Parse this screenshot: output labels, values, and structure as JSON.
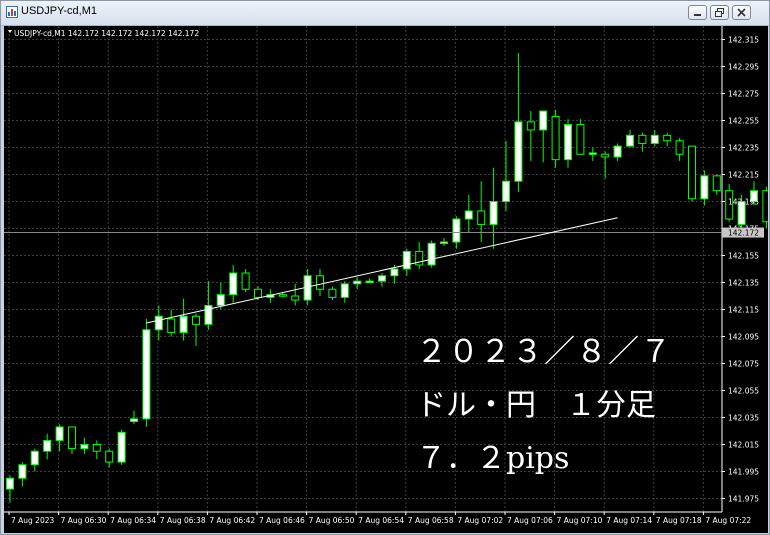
{
  "window": {
    "title": "USDJPY-cd,M1",
    "buttons": [
      "minimize-icon",
      "restore-icon",
      "close-icon"
    ]
  },
  "chart_info": {
    "header": "USDJPY-cd,M1 142.172 142.172 142.172 142.172",
    "current_price_label": "142.172"
  },
  "overlay": {
    "line1": "２０２３／８／７",
    "line2": "ドル・円　１分足",
    "line3": "７．２pips"
  },
  "colors": {
    "background": "#000000",
    "grid": "#3c3c3c",
    "bull_fill": "#ffffff",
    "bear_fill": "#000000",
    "candle_outline": "#00ff00",
    "axis_text": "#ffffff",
    "price_line": "#8a8a8a"
  },
  "chart_data": {
    "type": "candlestick",
    "symbol": "USDJPY-cd",
    "timeframe": "M1",
    "ylim": [
      141.965,
      142.325
    ],
    "y_ticks": [
      "142.315",
      "142.295",
      "142.275",
      "142.255",
      "142.235",
      "142.215",
      "142.195",
      "142.175",
      "142.155",
      "142.135",
      "142.115",
      "142.095",
      "142.075",
      "142.055",
      "142.035",
      "142.015",
      "141.995",
      "141.975"
    ],
    "y_tick_values": [
      142.315,
      142.295,
      142.275,
      142.255,
      142.235,
      142.215,
      142.195,
      142.175,
      142.155,
      142.135,
      142.115,
      142.095,
      142.075,
      142.055,
      142.035,
      142.015,
      141.995,
      141.975
    ],
    "x_ticks": [
      "7 Aug 2023",
      "7 Aug 06:30",
      "7 Aug 06:34",
      "7 Aug 06:38",
      "7 Aug 06:42",
      "7 Aug 06:46",
      "7 Aug 06:50",
      "7 Aug 06:54",
      "7 Aug 06:58",
      "7 Aug 07:02",
      "7 Aug 07:06",
      "7 Aug 07:10",
      "7 Aug 07:14",
      "7 Aug 07:18",
      "7 Aug 07:22"
    ],
    "current_price": 142.172,
    "trendline": {
      "from": [
        11,
        142.105
      ],
      "to": [
        49,
        142.183
      ]
    },
    "candles": [
      {
        "o": 141.982,
        "h": 141.992,
        "l": 141.972,
        "c": 141.99
      },
      {
        "o": 141.99,
        "h": 142.002,
        "l": 141.984,
        "c": 142.0
      },
      {
        "o": 142.0,
        "h": 142.012,
        "l": 141.995,
        "c": 142.01
      },
      {
        "o": 142.01,
        "h": 142.023,
        "l": 142.004,
        "c": 142.018
      },
      {
        "o": 142.018,
        "h": 142.03,
        "l": 142.01,
        "c": 142.028
      },
      {
        "o": 142.028,
        "h": 142.028,
        "l": 142.008,
        "c": 142.012
      },
      {
        "o": 142.012,
        "h": 142.02,
        "l": 142.008,
        "c": 142.015
      },
      {
        "o": 142.015,
        "h": 142.018,
        "l": 142.004,
        "c": 142.01
      },
      {
        "o": 142.01,
        "h": 142.012,
        "l": 141.998,
        "c": 142.002
      },
      {
        "o": 142.002,
        "h": 142.026,
        "l": 142.0,
        "c": 142.024
      },
      {
        "o": 142.032,
        "h": 142.04,
        "l": 142.03,
        "c": 142.034
      },
      {
        "o": 142.034,
        "h": 142.108,
        "l": 142.028,
        "c": 142.1
      },
      {
        "o": 142.1,
        "h": 142.118,
        "l": 142.092,
        "c": 142.11
      },
      {
        "o": 142.108,
        "h": 142.115,
        "l": 142.095,
        "c": 142.098
      },
      {
        "o": 142.098,
        "h": 142.123,
        "l": 142.092,
        "c": 142.11
      },
      {
        "o": 142.11,
        "h": 142.112,
        "l": 142.088,
        "c": 142.104
      },
      {
        "o": 142.104,
        "h": 142.136,
        "l": 142.1,
        "c": 142.118
      },
      {
        "o": 142.118,
        "h": 142.135,
        "l": 142.115,
        "c": 142.126
      },
      {
        "o": 142.126,
        "h": 142.148,
        "l": 142.12,
        "c": 142.142
      },
      {
        "o": 142.142,
        "h": 142.145,
        "l": 142.128,
        "c": 142.13
      },
      {
        "o": 142.13,
        "h": 142.132,
        "l": 142.122,
        "c": 142.124
      },
      {
        "o": 142.124,
        "h": 142.13,
        "l": 142.12,
        "c": 142.126
      },
      {
        "o": 142.126,
        "h": 142.128,
        "l": 142.124,
        "c": 142.125
      },
      {
        "o": 142.125,
        "h": 142.134,
        "l": 142.118,
        "c": 142.122
      },
      {
        "o": 142.122,
        "h": 142.145,
        "l": 142.118,
        "c": 142.14
      },
      {
        "o": 142.14,
        "h": 142.145,
        "l": 142.125,
        "c": 142.13
      },
      {
        "o": 142.13,
        "h": 142.132,
        "l": 142.122,
        "c": 142.124
      },
      {
        "o": 142.124,
        "h": 142.136,
        "l": 142.12,
        "c": 142.134
      },
      {
        "o": 142.134,
        "h": 142.139,
        "l": 142.13,
        "c": 142.136
      },
      {
        "o": 142.136,
        "h": 142.138,
        "l": 142.135,
        "c": 142.136
      },
      {
        "o": 142.136,
        "h": 142.142,
        "l": 142.132,
        "c": 142.14
      },
      {
        "o": 142.14,
        "h": 142.148,
        "l": 142.134,
        "c": 142.145
      },
      {
        "o": 142.145,
        "h": 142.16,
        "l": 142.14,
        "c": 142.158
      },
      {
        "o": 142.158,
        "h": 142.165,
        "l": 142.145,
        "c": 142.148
      },
      {
        "o": 142.148,
        "h": 142.166,
        "l": 142.146,
        "c": 142.164
      },
      {
        "o": 142.164,
        "h": 142.168,
        "l": 142.162,
        "c": 142.165
      },
      {
        "o": 142.165,
        "h": 142.184,
        "l": 142.16,
        "c": 142.182
      },
      {
        "o": 142.182,
        "h": 142.2,
        "l": 142.172,
        "c": 142.188
      },
      {
        "o": 142.188,
        "h": 142.21,
        "l": 142.165,
        "c": 142.178
      },
      {
        "o": 142.178,
        "h": 142.22,
        "l": 142.16,
        "c": 142.195
      },
      {
        "o": 142.195,
        "h": 142.24,
        "l": 142.188,
        "c": 142.21
      },
      {
        "o": 142.21,
        "h": 142.305,
        "l": 142.202,
        "c": 142.254
      },
      {
        "o": 142.254,
        "h": 142.262,
        "l": 142.225,
        "c": 142.248
      },
      {
        "o": 142.248,
        "h": 142.262,
        "l": 142.224,
        "c": 142.262
      },
      {
        "o": 142.258,
        "h": 142.263,
        "l": 142.22,
        "c": 142.226
      },
      {
        "o": 142.226,
        "h": 142.256,
        "l": 142.22,
        "c": 142.252
      },
      {
        "o": 142.252,
        "h": 142.256,
        "l": 142.23,
        "c": 142.23
      },
      {
        "o": 142.23,
        "h": 142.235,
        "l": 142.225,
        "c": 142.231
      },
      {
        "o": 142.23,
        "h": 142.232,
        "l": 142.212,
        "c": 142.228
      },
      {
        "o": 142.228,
        "h": 142.238,
        "l": 142.225,
        "c": 142.236
      },
      {
        "o": 142.236,
        "h": 142.248,
        "l": 142.235,
        "c": 142.244
      },
      {
        "o": 142.244,
        "h": 142.246,
        "l": 142.232,
        "c": 142.238
      },
      {
        "o": 142.238,
        "h": 142.248,
        "l": 142.236,
        "c": 142.244
      },
      {
        "o": 142.244,
        "h": 142.246,
        "l": 142.236,
        "c": 142.24
      },
      {
        "o": 142.24,
        "h": 142.242,
        "l": 142.225,
        "c": 142.23
      },
      {
        "o": 142.236,
        "h": 142.236,
        "l": 142.195,
        "c": 142.197
      },
      {
        "o": 142.197,
        "h": 142.218,
        "l": 142.192,
        "c": 142.214
      },
      {
        "o": 142.214,
        "h": 142.215,
        "l": 142.2,
        "c": 142.203
      },
      {
        "o": 142.203,
        "h": 142.208,
        "l": 142.18,
        "c": 142.182
      },
      {
        "o": 142.178,
        "h": 142.2,
        "l": 142.176,
        "c": 142.195
      },
      {
        "o": 142.195,
        "h": 142.21,
        "l": 142.192,
        "c": 142.203
      },
      {
        "o": 142.203,
        "h": 142.206,
        "l": 142.175,
        "c": 142.18
      },
      {
        "o": 142.18,
        "h": 142.182,
        "l": 142.164,
        "c": 142.17
      },
      {
        "o": 142.17,
        "h": 142.176,
        "l": 142.15,
        "c": 142.155
      },
      {
        "o": 142.155,
        "h": 142.158,
        "l": 142.14,
        "c": 142.145
      },
      {
        "o": 142.152,
        "h": 142.156,
        "l": 142.14,
        "c": 142.153
      },
      {
        "o": 142.155,
        "h": 142.16,
        "l": 142.118,
        "c": 142.13
      }
    ]
  }
}
